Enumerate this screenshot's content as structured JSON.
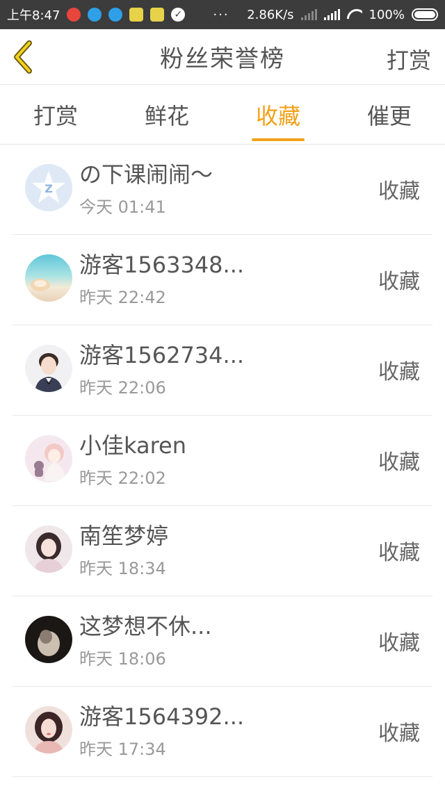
{
  "status_bar": {
    "time": "上午8:47",
    "net_speed": "2.86K/s",
    "battery": "100%"
  },
  "header": {
    "title": "粉丝荣誉榜",
    "right_action": "打赏"
  },
  "tabs": [
    {
      "label": "打赏",
      "active": false
    },
    {
      "label": "鲜花",
      "active": false
    },
    {
      "label": "收藏",
      "active": true
    },
    {
      "label": "催更",
      "active": false
    }
  ],
  "colors": {
    "accent": "#f2a118",
    "status_bar": "#3c3c3c"
  },
  "fans": [
    {
      "name": "の下课闹闹～",
      "time": "今天 01:41",
      "action": "收藏"
    },
    {
      "name": "游客1563348...",
      "time": "昨天 22:42",
      "action": "收藏"
    },
    {
      "name": "游客1562734...",
      "time": "昨天 22:06",
      "action": "收藏"
    },
    {
      "name": "小佳karen",
      "time": "昨天 22:02",
      "action": "收藏"
    },
    {
      "name": "南笙梦婷",
      "time": "昨天 18:34",
      "action": "收藏"
    },
    {
      "name": "这梦想不休...",
      "time": "昨天 18:06",
      "action": "收藏"
    },
    {
      "name": "游客1564392...",
      "time": "昨天 17:34",
      "action": "收藏"
    }
  ]
}
